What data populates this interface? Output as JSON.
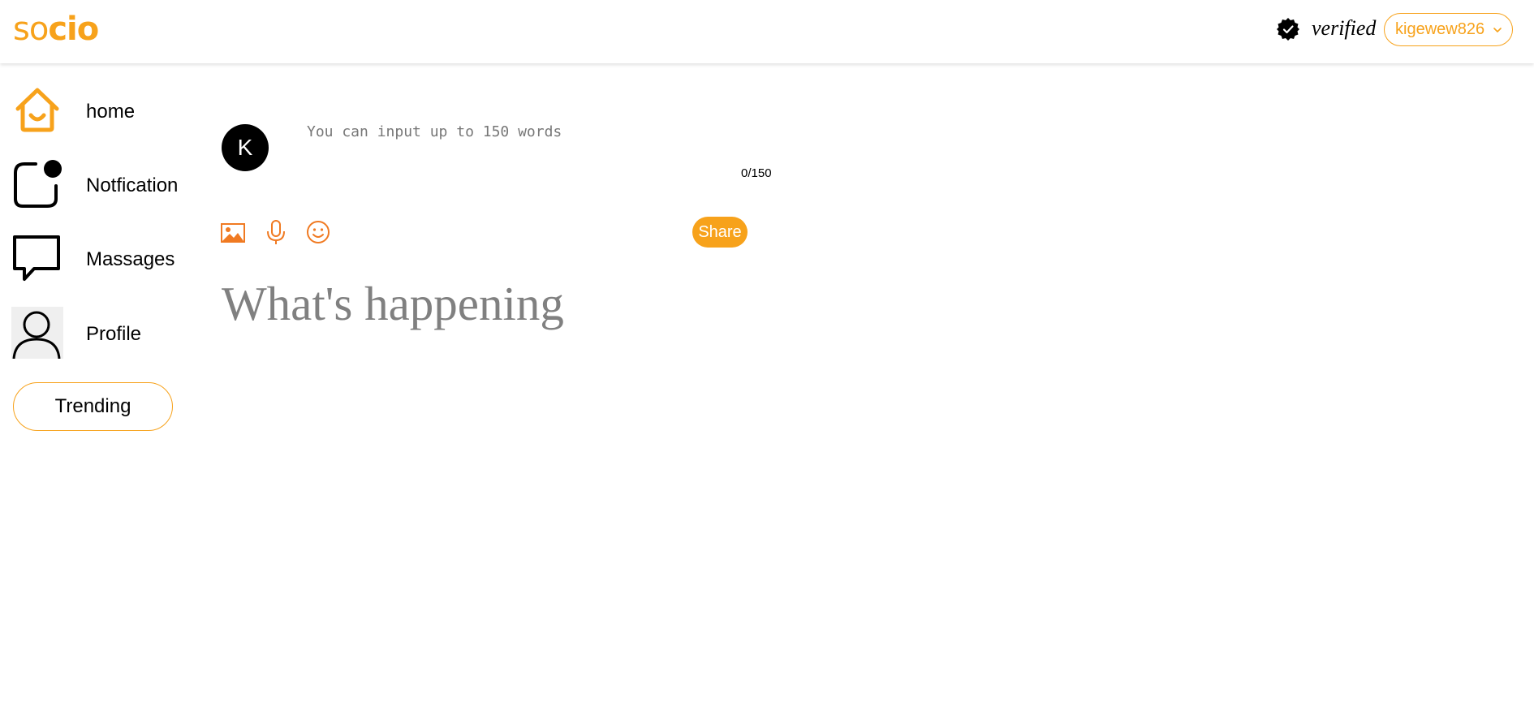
{
  "header": {
    "logo_part1": "so",
    "logo_part2": "cio",
    "verified_label": "verified",
    "username": "kigewew826"
  },
  "sidebar": {
    "items": [
      {
        "label": "home",
        "icon": "home-icon"
      },
      {
        "label": "Notfication",
        "icon": "notification-icon"
      },
      {
        "label": "Massages",
        "icon": "message-icon"
      },
      {
        "label": "Profile",
        "icon": "profile-icon"
      }
    ],
    "trending_label": "Trending"
  },
  "composer": {
    "avatar_letter": "K",
    "placeholder": "You can input up to 150 words",
    "value": "",
    "counter": "0/150",
    "tools": [
      "image-icon",
      "microphone-icon",
      "emoji-icon"
    ],
    "share_label": "Share"
  },
  "feed": {
    "heading": "What's happening"
  },
  "colors": {
    "accent": "#f7a21b",
    "icon_orange": "#f07a22",
    "heading_gray": "#808080"
  }
}
